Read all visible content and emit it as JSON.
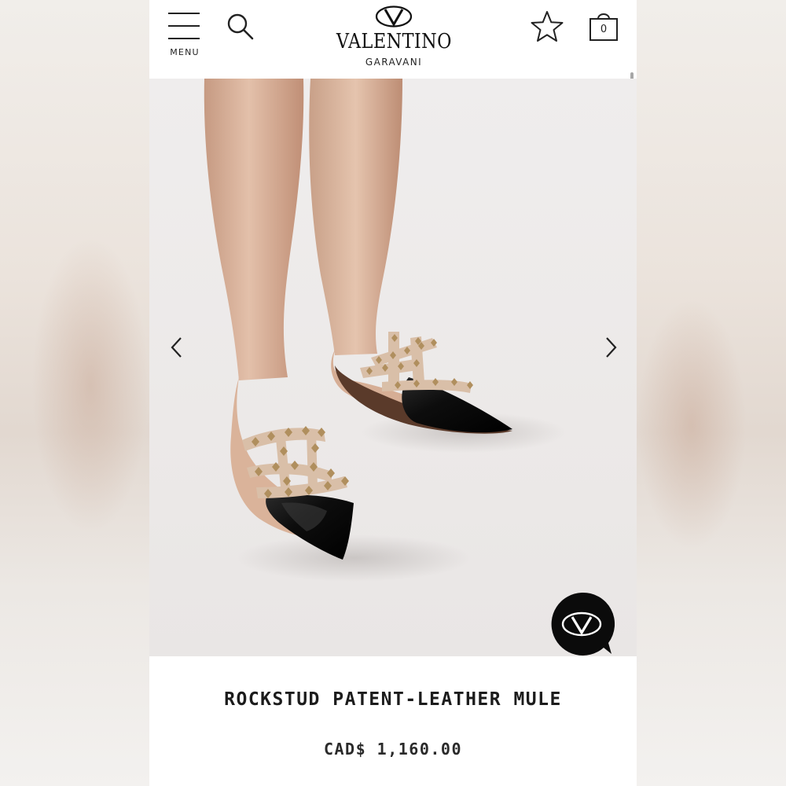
{
  "header": {
    "menu_label": "MENU",
    "brand_name": "VALENTINO",
    "brand_sub": "GARAVANI",
    "brand_monogram": "V",
    "bag_count": "0",
    "icons": [
      "menu-icon",
      "search-icon",
      "valentino-logo",
      "star-icon",
      "shopping-bag-icon"
    ]
  },
  "gallery": {
    "prev_icon": "chevron-left-icon",
    "next_icon": "chevron-right-icon",
    "chat_icon": "valentino-chat-icon"
  },
  "product": {
    "title": "ROCKSTUD PATENT-LEATHER MULE",
    "price": "CAD$ 1,160.00"
  },
  "colors": {
    "background": "#ffffff",
    "text": "#1c1c1c",
    "hero_bg": "#ece9e8",
    "shoe_black": "#111111",
    "strap_nude": "#d9bfa8",
    "stud_gold": "#b08f5e"
  }
}
